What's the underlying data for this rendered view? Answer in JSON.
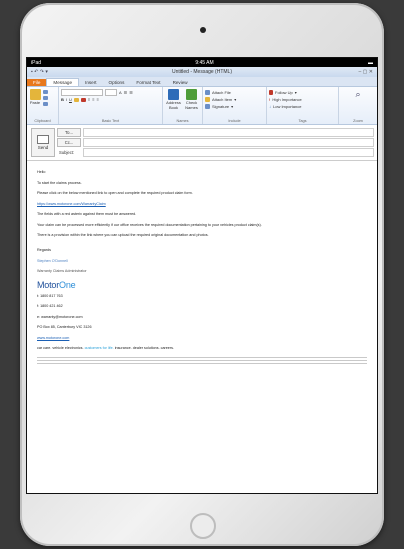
{
  "status_bar": {
    "carrier": "iPad",
    "time": "9:45 AM"
  },
  "window": {
    "title": "Untitled - Message (HTML)"
  },
  "tabs": [
    "File",
    "Message",
    "Insert",
    "Options",
    "Format Text",
    "Review"
  ],
  "ribbon": {
    "clipboard": {
      "paste": "Paste",
      "label": "Clipboard"
    },
    "basic_text": {
      "label": "Basic Text",
      "font_size": "A"
    },
    "names": {
      "address_book": "Address Book",
      "check_names": "Check Names",
      "label": "Names"
    },
    "include": {
      "attach_file": "Attach File",
      "attach_item": "Attach Item",
      "signature": "Signature",
      "label": "Include"
    },
    "tags": {
      "follow_up": "Follow Up",
      "high_importance": "High Importance",
      "low_importance": "Low Importance",
      "label": "Tags"
    },
    "zoom": {
      "label": "Zoom"
    }
  },
  "header": {
    "send": "Send",
    "to": "To...",
    "cc": "Cc...",
    "subject": "Subject:"
  },
  "body": {
    "greeting": "Hello",
    "line1": "To start the claims process.",
    "line2": "Please click on the below mentioned link to open and complete the required product claim form.",
    "link": "https://www.motorone.com/WarrantyClaim",
    "line3": "The fields with a red asterix against them must be answered.",
    "line4": "Your claim can be processed more efficiently if our office receives the required documentation pertaining to your vehicles product claim(s).",
    "line5": "There is a provision within the link where you can upload the required original documentation and photos.",
    "regards": "Regards",
    "sig_name": "Stephen O'Donnell",
    "sig_title": "Warranty Claims Administrator",
    "logo_a": "Motor",
    "logo_b": "One",
    "phone": "t: 1800 817 763",
    "fax": "f: 1800 421 462",
    "email": "e: warranty@motorone.com",
    "po_box": "PO Box 85, Canterbury VIC 3126",
    "website": "www.motorone.com",
    "tagline_a": "car care. vehicle electronics.",
    "tagline_b": "customers for life.",
    "tagline_c": "insurance. dealer solutions. careers."
  }
}
